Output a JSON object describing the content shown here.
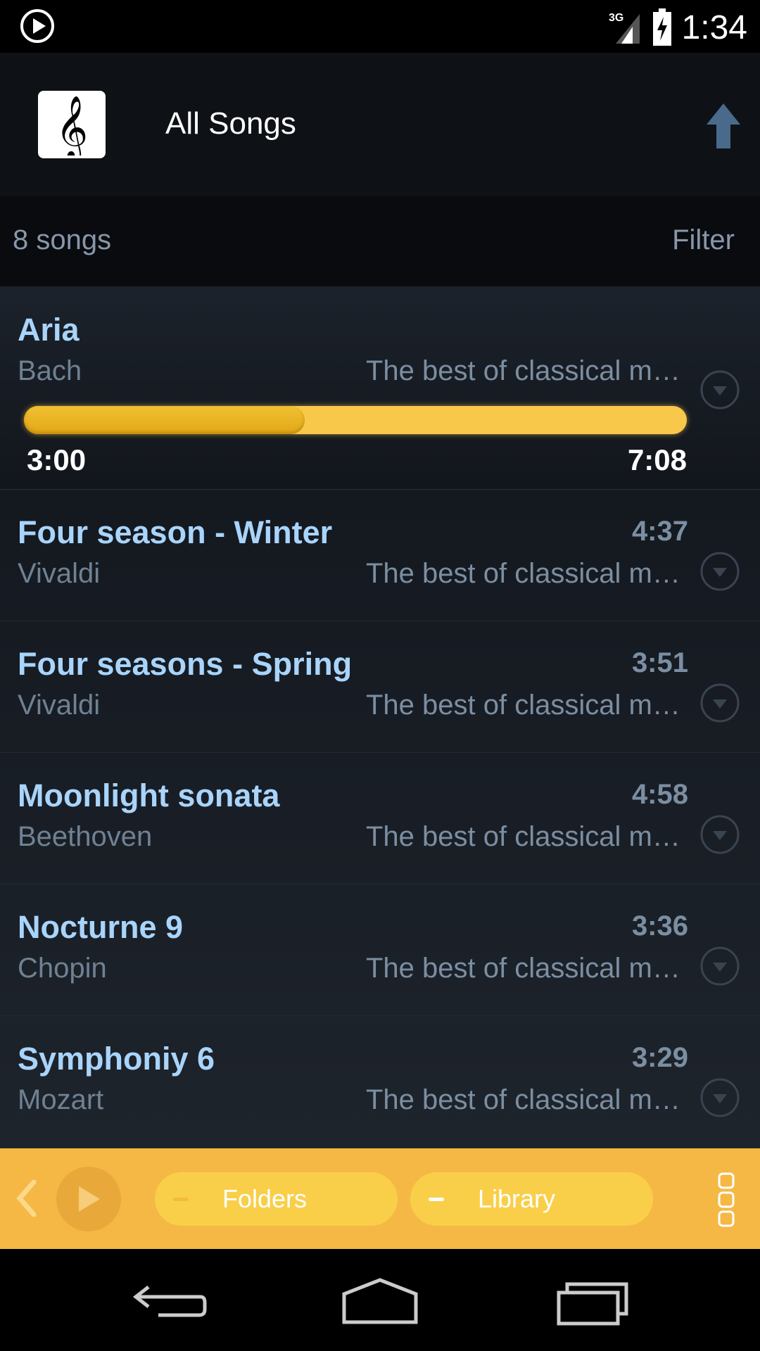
{
  "status_bar": {
    "time": "1:34",
    "network": "3G",
    "icons": [
      "play-circle-icon",
      "signal-icon",
      "battery-charging-icon"
    ]
  },
  "header": {
    "title": "All Songs",
    "app_icon": "treble-clef-icon",
    "action_icon": "arrow-up-icon"
  },
  "subheader": {
    "count_label": "8 songs",
    "filter_label": "Filter"
  },
  "now_playing": {
    "elapsed": "3:00",
    "total": "7:08",
    "progress_fraction": 0.4236
  },
  "songs": [
    {
      "title": "Aria",
      "artist": "Bach",
      "album": "The best of classical music",
      "duration": ""
    },
    {
      "title": "Four season - Winter",
      "artist": "Vivaldi",
      "album": "The best of classical music",
      "duration": "4:37"
    },
    {
      "title": "Four seasons - Spring",
      "artist": "Vivaldi",
      "album": "The best of classical music",
      "duration": "3:51"
    },
    {
      "title": "Moonlight sonata",
      "artist": "Beethoven",
      "album": "The best of classical music",
      "duration": "4:58"
    },
    {
      "title": "Nocturne 9",
      "artist": "Chopin",
      "album": "The best of classical music",
      "duration": "3:36"
    },
    {
      "title": "Symphoniy 6",
      "artist": "Mozart",
      "album": "The best of classical music",
      "duration": "3:29"
    }
  ],
  "bottom_bar": {
    "folders_label": "Folders",
    "library_label": "Library",
    "accent": "#f6b845",
    "pill_color": "#f9cf4a"
  },
  "nav_bar": {
    "icons": [
      "back-icon",
      "home-icon",
      "recents-icon"
    ]
  },
  "colors": {
    "title_blue": "#a9d4fb",
    "muted_text": "#7b8ea2",
    "progress_yellow": "#f8c84a"
  }
}
